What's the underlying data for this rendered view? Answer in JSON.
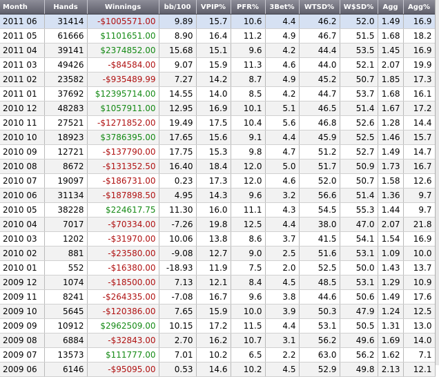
{
  "colors": {
    "positive": "#158a15",
    "negative": "#b01212",
    "header": "#6e6e7a",
    "selected": "#d6e1f3"
  },
  "headers": [
    "Month",
    "Hands",
    "Winnings",
    "bb/100",
    "VPIP%",
    "PFR%",
    "3Bet%",
    "WTSD%",
    "W$SD%",
    "Agg",
    "Agg%"
  ],
  "rows": [
    [
      "2011 06",
      "31414",
      "-$1005571.00",
      "9.89",
      "15.7",
      "10.6",
      "4.4",
      "46.2",
      "52.0",
      "1.49",
      "16.9"
    ],
    [
      "2011 05",
      "61666",
      "$1101651.00",
      "8.90",
      "16.4",
      "11.2",
      "4.9",
      "46.7",
      "51.5",
      "1.68",
      "18.2"
    ],
    [
      "2011 04",
      "39141",
      "$2374852.00",
      "15.68",
      "15.1",
      "9.6",
      "4.2",
      "44.4",
      "53.5",
      "1.45",
      "16.9"
    ],
    [
      "2011 03",
      "49426",
      "-$84584.00",
      "9.07",
      "15.9",
      "11.3",
      "4.6",
      "44.0",
      "52.1",
      "2.07",
      "19.9"
    ],
    [
      "2011 02",
      "23582",
      "-$935489.99",
      "7.27",
      "14.2",
      "8.7",
      "4.9",
      "45.2",
      "50.7",
      "1.85",
      "17.3"
    ],
    [
      "2011 01",
      "37692",
      "$12395714.00",
      "14.55",
      "14.0",
      "8.5",
      "4.2",
      "44.7",
      "53.7",
      "1.68",
      "16.1"
    ],
    [
      "2010 12",
      "48283",
      "$1057911.00",
      "12.95",
      "16.9",
      "10.1",
      "5.1",
      "46.5",
      "51.4",
      "1.67",
      "17.2"
    ],
    [
      "2010 11",
      "27521",
      "-$1271852.00",
      "19.49",
      "17.5",
      "10.4",
      "5.6",
      "46.8",
      "52.6",
      "1.28",
      "14.4"
    ],
    [
      "2010 10",
      "18923",
      "$3786395.00",
      "17.65",
      "15.6",
      "9.1",
      "4.4",
      "45.9",
      "52.5",
      "1.46",
      "15.7"
    ],
    [
      "2010 09",
      "12721",
      "-$137790.00",
      "17.75",
      "15.3",
      "9.8",
      "4.7",
      "51.2",
      "52.7",
      "1.49",
      "14.7"
    ],
    [
      "2010 08",
      "8672",
      "-$131352.50",
      "16.40",
      "18.4",
      "12.0",
      "5.0",
      "51.7",
      "50.9",
      "1.73",
      "16.7"
    ],
    [
      "2010 07",
      "19097",
      "-$186731.00",
      "0.23",
      "17.3",
      "12.0",
      "4.6",
      "52.0",
      "50.7",
      "1.58",
      "12.6"
    ],
    [
      "2010 06",
      "31134",
      "-$187898.50",
      "4.95",
      "14.3",
      "9.6",
      "3.2",
      "56.6",
      "51.4",
      "1.36",
      "9.7"
    ],
    [
      "2010 05",
      "38228",
      "$224617.75",
      "11.30",
      "16.0",
      "11.1",
      "4.3",
      "54.5",
      "55.3",
      "1.44",
      "9.7"
    ],
    [
      "2010 04",
      "7017",
      "-$70334.00",
      "-7.26",
      "19.8",
      "12.5",
      "4.4",
      "38.0",
      "47.0",
      "2.07",
      "21.8"
    ],
    [
      "2010 03",
      "1202",
      "-$31970.00",
      "10.06",
      "13.8",
      "8.6",
      "3.7",
      "41.5",
      "54.1",
      "1.54",
      "16.9"
    ],
    [
      "2010 02",
      "881",
      "-$23580.00",
      "-9.08",
      "12.7",
      "9.0",
      "2.5",
      "51.6",
      "53.1",
      "1.09",
      "10.0"
    ],
    [
      "2010 01",
      "552",
      "-$16380.00",
      "-18.93",
      "11.9",
      "7.5",
      "2.0",
      "52.5",
      "50.0",
      "1.43",
      "13.7"
    ],
    [
      "2009 12",
      "1074",
      "-$18500.00",
      "7.13",
      "12.1",
      "8.4",
      "4.5",
      "48.5",
      "53.1",
      "1.29",
      "10.9"
    ],
    [
      "2009 11",
      "8241",
      "-$264335.00",
      "-7.08",
      "16.7",
      "9.6",
      "3.8",
      "44.6",
      "50.6",
      "1.49",
      "17.6"
    ],
    [
      "2009 10",
      "5645",
      "-$120386.00",
      "7.65",
      "15.9",
      "10.0",
      "3.9",
      "50.3",
      "47.9",
      "1.24",
      "12.5"
    ],
    [
      "2009 09",
      "10912",
      "$2962509.00",
      "10.15",
      "17.2",
      "11.5",
      "4.4",
      "53.1",
      "50.5",
      "1.31",
      "13.0"
    ],
    [
      "2009 08",
      "6884",
      "-$32843.00",
      "2.70",
      "16.2",
      "10.7",
      "3.1",
      "56.2",
      "49.6",
      "1.69",
      "14.0"
    ],
    [
      "2009 07",
      "13573",
      "$111777.00",
      "7.01",
      "10.2",
      "6.5",
      "2.2",
      "63.0",
      "56.2",
      "1.62",
      "7.1"
    ],
    [
      "2009 06",
      "6146",
      "-$95095.00",
      "0.53",
      "14.6",
      "10.2",
      "4.5",
      "52.9",
      "49.8",
      "2.13",
      "12.1"
    ]
  ]
}
